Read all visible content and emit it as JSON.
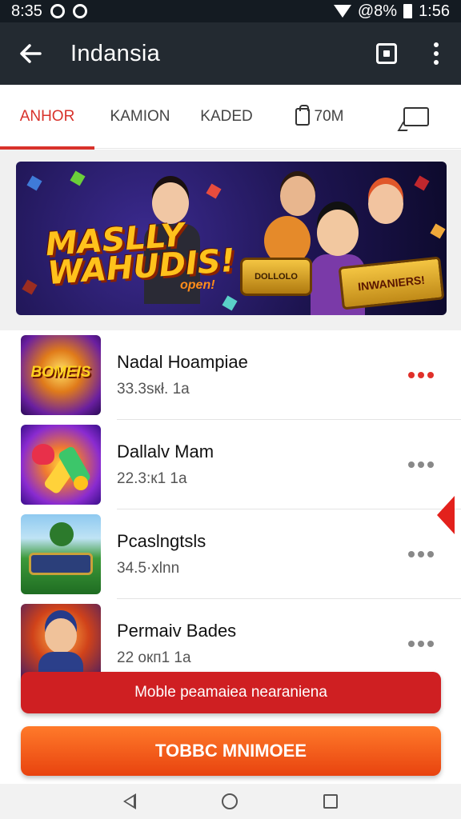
{
  "status_bar": {
    "time_left": "8:35",
    "battery_text": "@8%",
    "time_right": "1:56",
    "icons": [
      "circle-icon",
      "navigation-icon",
      "wifi-icon",
      "battery-icon"
    ]
  },
  "app_bar": {
    "title": "Indansia",
    "back_icon": "arrow-left-icon",
    "actions": [
      "square-icon",
      "more-vert-icon"
    ]
  },
  "tabs": [
    {
      "label": "ANHOR",
      "active": true
    },
    {
      "label": "KAMION",
      "active": false
    },
    {
      "label": "KADED",
      "active": false
    },
    {
      "label": "70M",
      "icon": "bag-icon",
      "active": false
    },
    {
      "label": "",
      "icon": "chat-icon",
      "active": false
    }
  ],
  "banner": {
    "title_line1": "MASLLY",
    "title_line2": "WAHUDIS!",
    "subtitle": "open!",
    "badge_left": "DOLLOLO",
    "badge_right": "INWANIERS!"
  },
  "list": [
    {
      "title": "Nadal Hoampiae",
      "subtitle": "33.3sкł. 1а",
      "thumb_text": "BOMEIS",
      "more_color": "#e0302a"
    },
    {
      "title": "Dallalv Mam",
      "subtitle": "22.3:к1 1a",
      "thumb_text": "",
      "more_color": "#888888"
    },
    {
      "title": "Pcaslngtsls",
      "subtitle": "34.5·xlnn",
      "thumb_text": "",
      "more_color": "#888888"
    },
    {
      "title": "Permaiv Bades",
      "subtitle": "22 окп1 1a",
      "thumb_text": "",
      "more_color": "#888888"
    }
  ],
  "toast": {
    "text": "Moble peamaiea nearaniena"
  },
  "cta": {
    "label": "TOBBC MNIMOEE"
  },
  "nav": [
    "nav-back-icon",
    "nav-home-icon",
    "nav-recent-icon"
  ]
}
